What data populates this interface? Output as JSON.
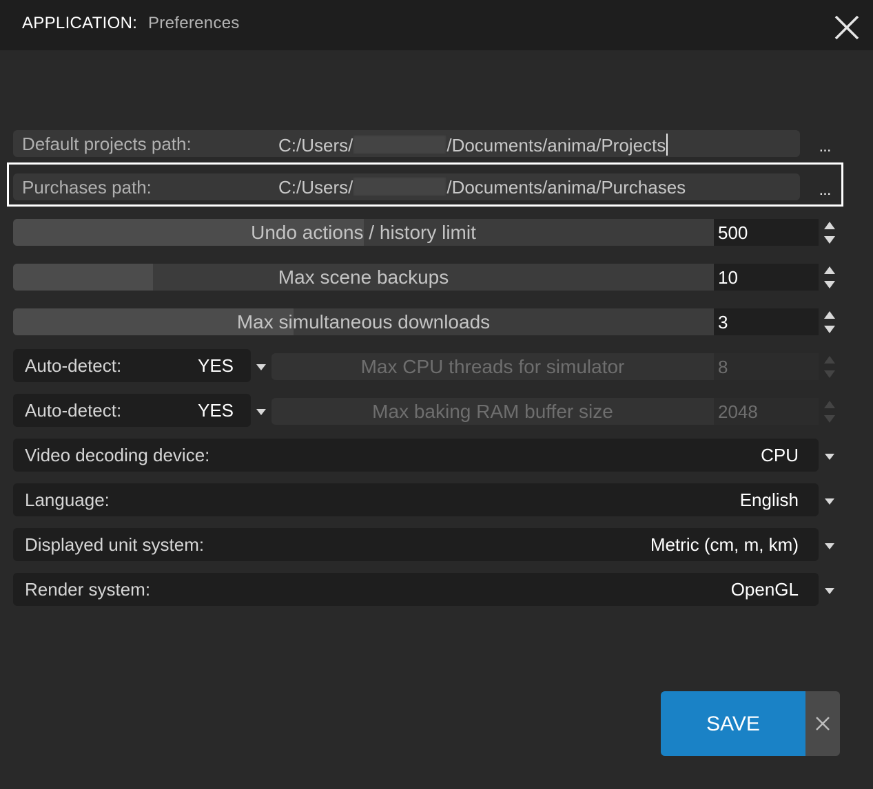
{
  "window": {
    "app_label": "APPLICATION:",
    "page_title": "Preferences",
    "close_icon": "close-icon"
  },
  "paths": {
    "projects": {
      "label": "Default projects path:",
      "value_prefix": "C:/Users/",
      "value_suffix": "/Documents/anima/Projects",
      "browse_label": "..."
    },
    "purchases": {
      "label": "Purchases path:",
      "value_prefix": "C:/Users/",
      "value_suffix": "/Documents/anima/Purchases",
      "browse_label": "..."
    }
  },
  "sliders": {
    "undo": {
      "label": "Undo actions / history limit",
      "value": "500",
      "fill_fraction": 0.5
    },
    "backups": {
      "label": "Max scene backups",
      "value": "10",
      "fill_fraction": 0.2
    },
    "downloads": {
      "label": "Max simultaneous downloads",
      "value": "3",
      "fill_fraction": 0.4
    }
  },
  "auto_detect": {
    "cpu": {
      "label": "Auto-detect:",
      "value": "YES",
      "slider_label": "Max CPU threads for simulator",
      "slider_value": "8"
    },
    "ram": {
      "label": "Auto-detect:",
      "value": "YES",
      "slider_label": "Max baking RAM buffer size",
      "slider_value": "2048"
    }
  },
  "dropdowns": {
    "video": {
      "label": "Video decoding device:",
      "value": "CPU"
    },
    "language": {
      "label": "Language:",
      "value": "English"
    },
    "units": {
      "label": "Displayed unit system:",
      "value": "Metric (cm, m, km)"
    },
    "render": {
      "label": "Render system:",
      "value": "OpenGL"
    }
  },
  "footer": {
    "save_label": "SAVE",
    "cancel_icon": "close-icon"
  },
  "colors": {
    "accent": "#1a82c6",
    "background": "#292929",
    "titlebar": "#1e1e1e"
  }
}
